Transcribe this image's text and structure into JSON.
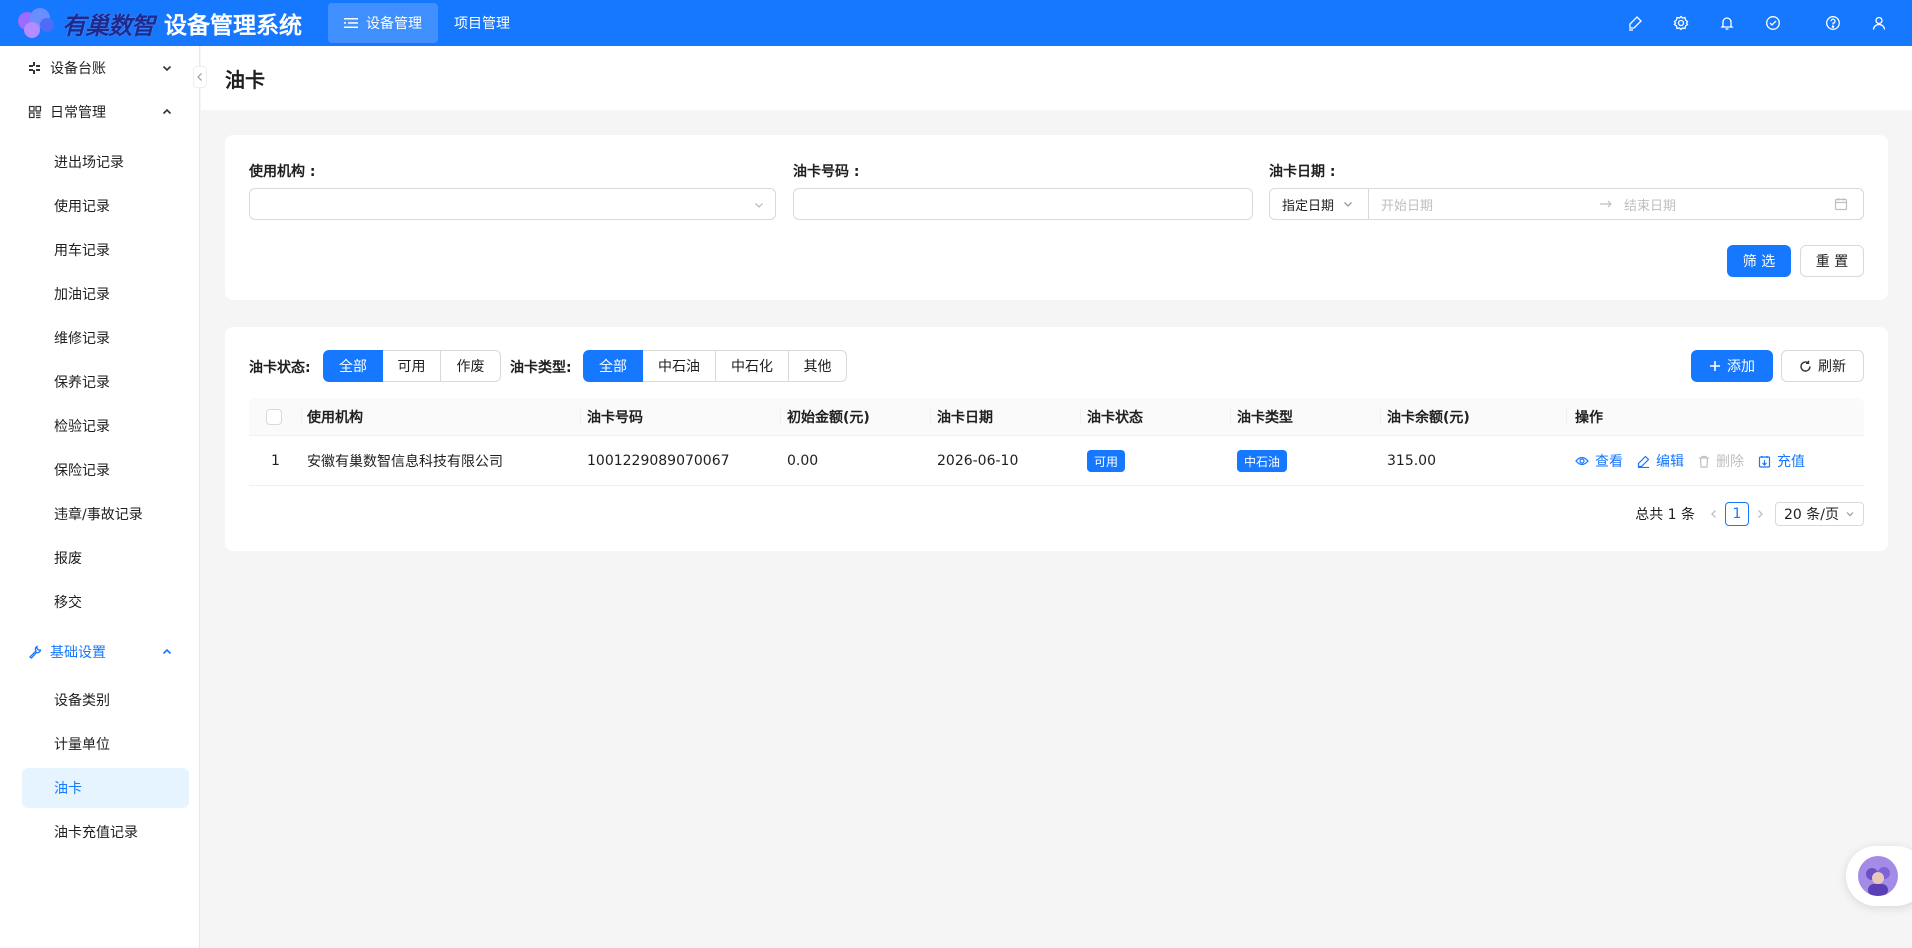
{
  "header": {
    "logo_text": "有巢数智",
    "system_title": "设备管理系统",
    "nav": [
      {
        "label": "设备管理",
        "active": true
      },
      {
        "label": "项目管理",
        "active": false
      }
    ],
    "icons": [
      "brush-icon",
      "gear-icon",
      "bell-icon",
      "check-circle-icon",
      "help-icon",
      "user-icon"
    ]
  },
  "sidebar": {
    "groups": [
      {
        "label": "设备台账",
        "icon": "grid-icon",
        "expanded": false,
        "items": []
      },
      {
        "label": "日常管理",
        "icon": "dashboard-icon",
        "expanded": true,
        "items": [
          "进出场记录",
          "使用记录",
          "用车记录",
          "加油记录",
          "维修记录",
          "保养记录",
          "检验记录",
          "保险记录",
          "违章/事故记录",
          "报废",
          "移交"
        ]
      },
      {
        "label": "基础设置",
        "icon": "tool-icon",
        "expanded": true,
        "active": true,
        "items": [
          "设备类别",
          "计量单位",
          "油卡",
          "油卡充值记录"
        ]
      }
    ],
    "selected": "油卡"
  },
  "page": {
    "title": "油卡"
  },
  "filter": {
    "org_label": "使用机构 :",
    "org_value": "",
    "card_no_label": "油卡号码 :",
    "card_no_value": "",
    "date_label": "油卡日期 :",
    "date_mode": "指定日期",
    "start_placeholder": "开始日期",
    "end_placeholder": "结束日期",
    "filter_btn": "筛 选",
    "reset_btn": "重 置"
  },
  "toolbar": {
    "status_label": "油卡状态:",
    "status_options": [
      "全部",
      "可用",
      "作废"
    ],
    "status_selected": "全部",
    "type_label": "油卡类型:",
    "type_options": [
      "全部",
      "中石油",
      "中石化",
      "其他"
    ],
    "type_selected": "全部",
    "add_btn": "添加",
    "refresh_btn": "刷新"
  },
  "table": {
    "columns": [
      "使用机构",
      "油卡号码",
      "初始金额(元)",
      "油卡日期",
      "油卡状态",
      "油卡类型",
      "油卡余额(元)",
      "操作"
    ],
    "rows": [
      {
        "index": "1",
        "org": "安徽有巢数智信息科技有限公司",
        "card_no": "1001229089070067",
        "initial": "0.00",
        "date": "2026-06-10",
        "status": "可用",
        "type": "中石油",
        "balance": "315.00"
      }
    ],
    "actions": [
      "查看",
      "编辑",
      "删除",
      "充值"
    ]
  },
  "pagination": {
    "total": "总共 1 条",
    "current": "1",
    "page_size": "20 条/页"
  },
  "colors": {
    "primary": "#1677ff",
    "bg": "#f5f5f5"
  }
}
